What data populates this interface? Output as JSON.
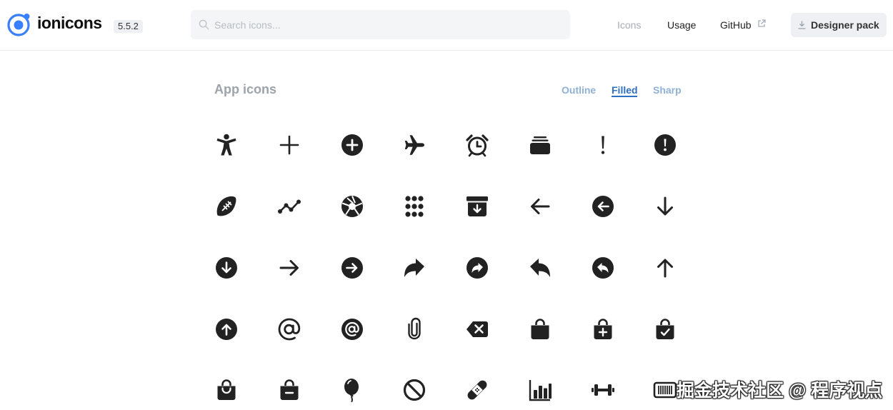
{
  "header": {
    "brand": "ionicons",
    "version": "5.5.2",
    "search": {
      "placeholder": "Search icons...",
      "value": ""
    },
    "nav": {
      "icons": "Icons",
      "usage": "Usage",
      "github": "GitHub"
    },
    "designer_pack": "Designer pack",
    "brand_color": "#3880ff"
  },
  "section": {
    "title": "App icons",
    "tabs": [
      "Outline",
      "Filled",
      "Sharp"
    ],
    "active_tab": "Filled"
  },
  "icons": [
    "accessibility",
    "add",
    "add-circle",
    "airplane",
    "alarm",
    "albums",
    "alert",
    "alert-circle",
    "american-football",
    "analytics",
    "aperture",
    "apps",
    "archive",
    "arrow-back",
    "arrow-back-circle",
    "arrow-down",
    "arrow-down-circle",
    "arrow-forward",
    "arrow-forward-circle",
    "arrow-redo",
    "arrow-redo-circle",
    "arrow-undo",
    "arrow-undo-circle",
    "arrow-up",
    "arrow-up-circle",
    "at",
    "at-circle",
    "attach",
    "backspace",
    "bag",
    "bag-add",
    "bag-check",
    "bag-handle",
    "bag-remove",
    "balloon",
    "ban",
    "bandage",
    "bar-chart",
    "barbell",
    "barcode"
  ],
  "watermark": "掘金技术社区 @ 程序视点"
}
